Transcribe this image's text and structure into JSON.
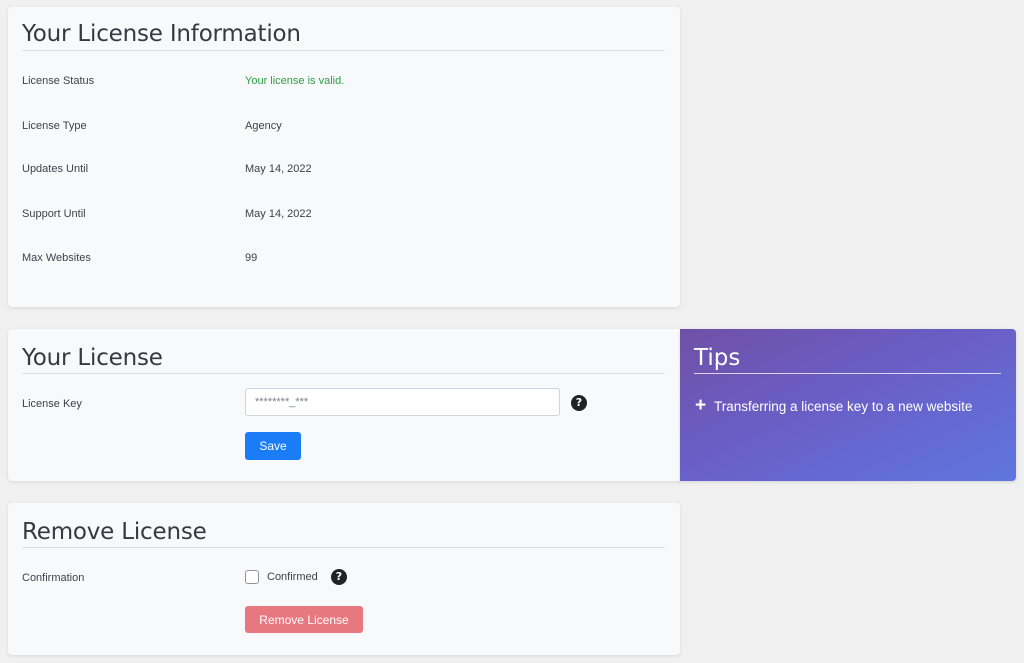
{
  "license_info": {
    "title": "Your License Information",
    "rows": [
      {
        "label": "License Status",
        "value": "Your license is valid."
      },
      {
        "label": "License Type",
        "value": "Agency"
      },
      {
        "label": "Updates Until",
        "value": "May 14, 2022"
      },
      {
        "label": "Support Until",
        "value": "May 14, 2022"
      },
      {
        "label": "Max Websites",
        "value": "99"
      }
    ]
  },
  "your_license": {
    "title": "Your License",
    "key_label": "License Key",
    "key_value": "********_***",
    "help_glyph": "?",
    "save_label": "Save"
  },
  "tips": {
    "title": "Tips",
    "items": [
      {
        "icon": "plus-icon",
        "text": "Transferring a license key to a new website"
      }
    ]
  },
  "remove_license": {
    "title": "Remove License",
    "confirm_label": "Confirmation",
    "checkbox_label": "Confirmed",
    "checkbox_checked": false,
    "help_glyph": "?",
    "button_label": "Remove License"
  },
  "colors": {
    "valid": "#2e9e44",
    "save_button": "#1a7cf7",
    "remove_button": "#e8787f",
    "tips_gradient_start": "#7050a6",
    "tips_gradient_end": "#5f76e0"
  }
}
